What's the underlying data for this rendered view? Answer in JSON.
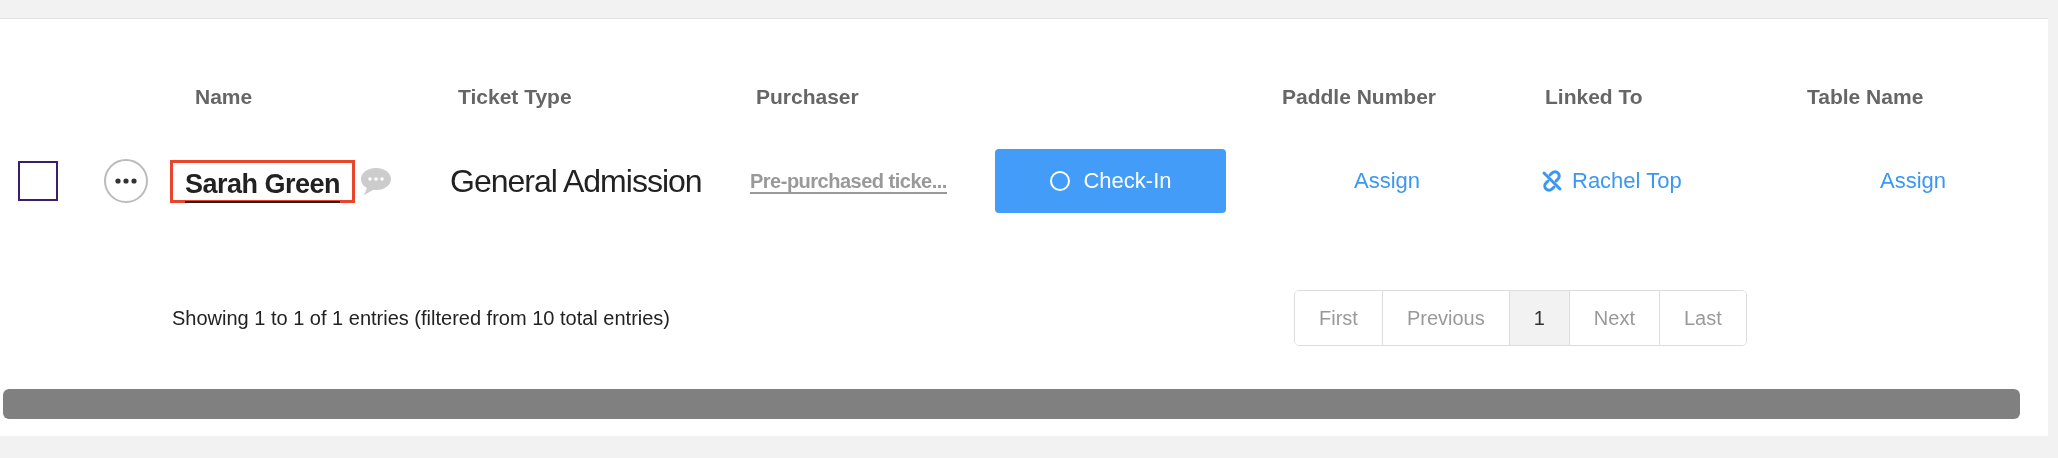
{
  "table": {
    "columns": [
      {
        "label": "Name"
      },
      {
        "label": "Ticket Type"
      },
      {
        "label": "Purchaser"
      },
      {
        "label": "Paddle Number"
      },
      {
        "label": "Linked To"
      },
      {
        "label": "Table Name"
      }
    ],
    "rows": [
      {
        "checked": false,
        "name": "Sarah Green",
        "highlighted": true,
        "ticket_type": "General Admission",
        "purchaser": "Pre-purchased ticke...",
        "check_in": "Check-In",
        "paddle_number": "Assign",
        "linked_to": "Rachel Top",
        "table_name": "Assign"
      }
    ]
  },
  "footer": {
    "info": "Showing 1 to 1 of 1 entries (filtered from 10 total entries)",
    "pagination": [
      {
        "label": "First",
        "selected": false
      },
      {
        "label": "Previous",
        "selected": false
      },
      {
        "label": "1",
        "selected": true
      },
      {
        "label": "Next",
        "selected": false
      },
      {
        "label": "Last",
        "selected": false
      }
    ]
  }
}
